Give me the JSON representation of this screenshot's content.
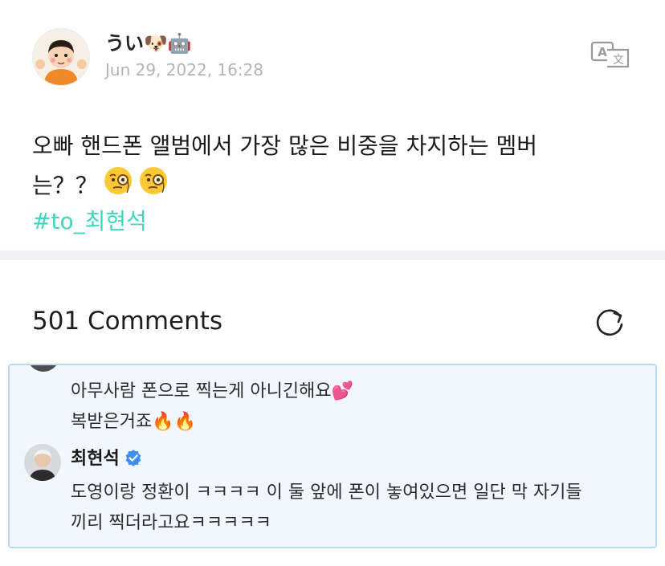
{
  "post": {
    "author": "うい🐶🤖",
    "date": "Jun 29, 2022, 16:28",
    "body_line1": "오빠 핸드폰 앨범에서 가장 많은 비중을 차지하는 멤버",
    "body_line2": "는？？",
    "hashtag": "#to_최현석"
  },
  "comments": {
    "count_label": "501 Comments"
  },
  "thread": {
    "parent_line1": "아무사람 폰으로 찍는게 아니긴해요💕",
    "parent_line2": "복받은거죠🔥🔥",
    "reply_author": "최현석",
    "reply_line1": "도영이랑 정환이 ㅋㅋㅋㅋ 이 둘 앞에 폰이 놓여있으면 일단 막 자기들",
    "reply_line2": "끼리 찍더라고요ㅋㅋㅋㅋㅋ"
  },
  "icons": {
    "translate": "translate-icon",
    "refresh": "refresh-icon",
    "verified": "verified-badge-icon",
    "thinking_emoji": "monocle-face-emoji"
  },
  "colors": {
    "hashtag": "#40d6bd",
    "highlight_bg": "#f1f7fd",
    "highlight_border": "#bcd8ef",
    "verified": "#3d8ff0",
    "meta_gray": "#b4b4b4"
  }
}
